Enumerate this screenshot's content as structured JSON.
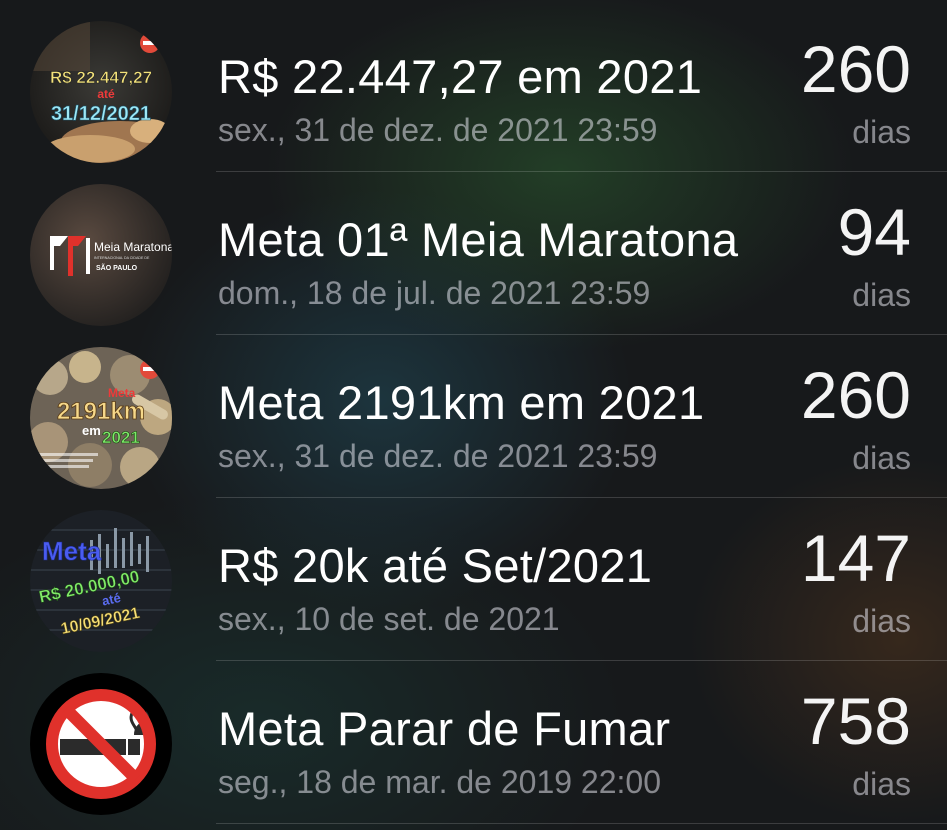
{
  "countdowns": [
    {
      "title": "R$ 22.447,27 em 2021",
      "date": "sex., 31 de dez. de 2021 23:59",
      "count": "260",
      "unit": "dias",
      "thumbnail_text": [
        "R$ 22.447,27",
        "até",
        "31/12/2021"
      ],
      "thumbnail_icon": "money-rolls-icon"
    },
    {
      "title": "Meta 01ª Meia Maratona",
      "date": "dom., 18 de jul. de 2021 23:59",
      "count": "94",
      "unit": "dias",
      "thumbnail_text": [
        "Meia Maratona",
        "INTERNACIONAL DA CIDADE DE",
        "SÃO PAULO"
      ],
      "thumbnail_icon": "marathon-logo-icon"
    },
    {
      "title": "Meta 2191km em 2021",
      "date": "sex., 31 de dez. de 2021 23:59",
      "count": "260",
      "unit": "dias",
      "thumbnail_text": [
        "Meta",
        "2191km",
        "em",
        "2021"
      ],
      "thumbnail_icon": "coins-icon"
    },
    {
      "title": "R$ 20k até Set/2021",
      "date": "sex., 10 de set. de 2021",
      "count": "147",
      "unit": "dias",
      "thumbnail_text": [
        "Meta",
        "R$ 20.000,00",
        "até",
        "10/09/2021"
      ],
      "thumbnail_icon": "stock-chart-icon"
    },
    {
      "title": "Meta Parar de Fumar",
      "date": "seg., 18 de mar. de 2019 22:00",
      "count": "758",
      "unit": "dias",
      "thumbnail_icon": "no-smoking-icon"
    }
  ],
  "colors": {
    "title": "#ffffff",
    "secondary": "#8e8e93",
    "no_smoking_red": "#e0312b"
  }
}
